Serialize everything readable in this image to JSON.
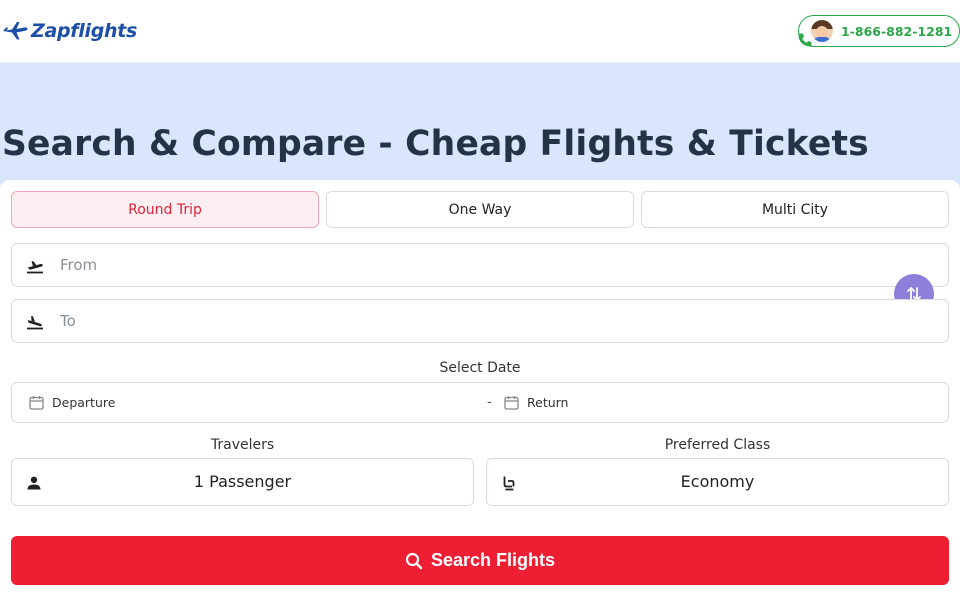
{
  "header": {
    "logo_text": "Zapflights",
    "phone_number": "1-866-882-1281"
  },
  "hero": {
    "title": "Search & Compare - Cheap Flights & Tickets"
  },
  "trip_tabs": [
    {
      "label": "Round Trip",
      "active": true
    },
    {
      "label": "One Way",
      "active": false
    },
    {
      "label": "Multi City",
      "active": false
    }
  ],
  "from_field": {
    "placeholder": "From",
    "icon": "takeoff-icon"
  },
  "to_field": {
    "placeholder": "To",
    "icon": "landing-icon"
  },
  "date": {
    "label": "Select Date",
    "departure": "Departure",
    "separator": "-",
    "return": "Return"
  },
  "travelers": {
    "label": "Travelers",
    "value": "1 Passenger"
  },
  "class": {
    "label": "Preferred Class",
    "value": "Economy"
  },
  "search_button": {
    "label": "Search Flights"
  },
  "colors": {
    "brand": "#1d4fa8",
    "accent": "#ee1f33",
    "phone_green": "#2aa84a",
    "hero_bg": "#d9e6fd",
    "swap_button": "#8e7fdb"
  }
}
